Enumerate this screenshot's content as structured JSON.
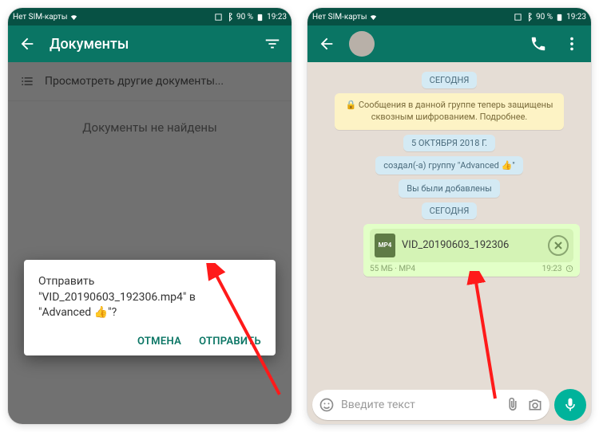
{
  "left": {
    "status": {
      "carrier": "Нет SIM-карты",
      "battery": "90 %",
      "time": "19:23"
    },
    "appbar": {
      "title": "Документы"
    },
    "browse_row": "Просмотреть другие документы...",
    "empty": "Документы не найдены",
    "dialog": {
      "line1": "Отправить",
      "line2": "\"VID_20190603_192306.mp4\" в",
      "line3": "\"Advanced 👍\"?",
      "cancel": "ОТМЕНА",
      "send": "ОТПРАВИТЬ"
    }
  },
  "right": {
    "status": {
      "carrier": "Нет SIM-карты",
      "battery": "90 %",
      "time": "19:23"
    },
    "chips": {
      "today1": "СЕГОДНЯ",
      "encryption": "🔒 Сообщения в данной группе теперь защищены сквозным шифрованием. Подробнее.",
      "date": "5 ОКТЯБРЯ 2018 Г.",
      "created": "создал(-а) группу \"Advanced 👍\"",
      "added": "Вы были добавлены",
      "today2": "СЕГОДНЯ"
    },
    "file": {
      "badge": "MP4",
      "name": "VID_20190603_192306",
      "size": "55 МБ · MP4",
      "time": "19:23"
    },
    "input": {
      "placeholder": "Введите текст"
    }
  }
}
